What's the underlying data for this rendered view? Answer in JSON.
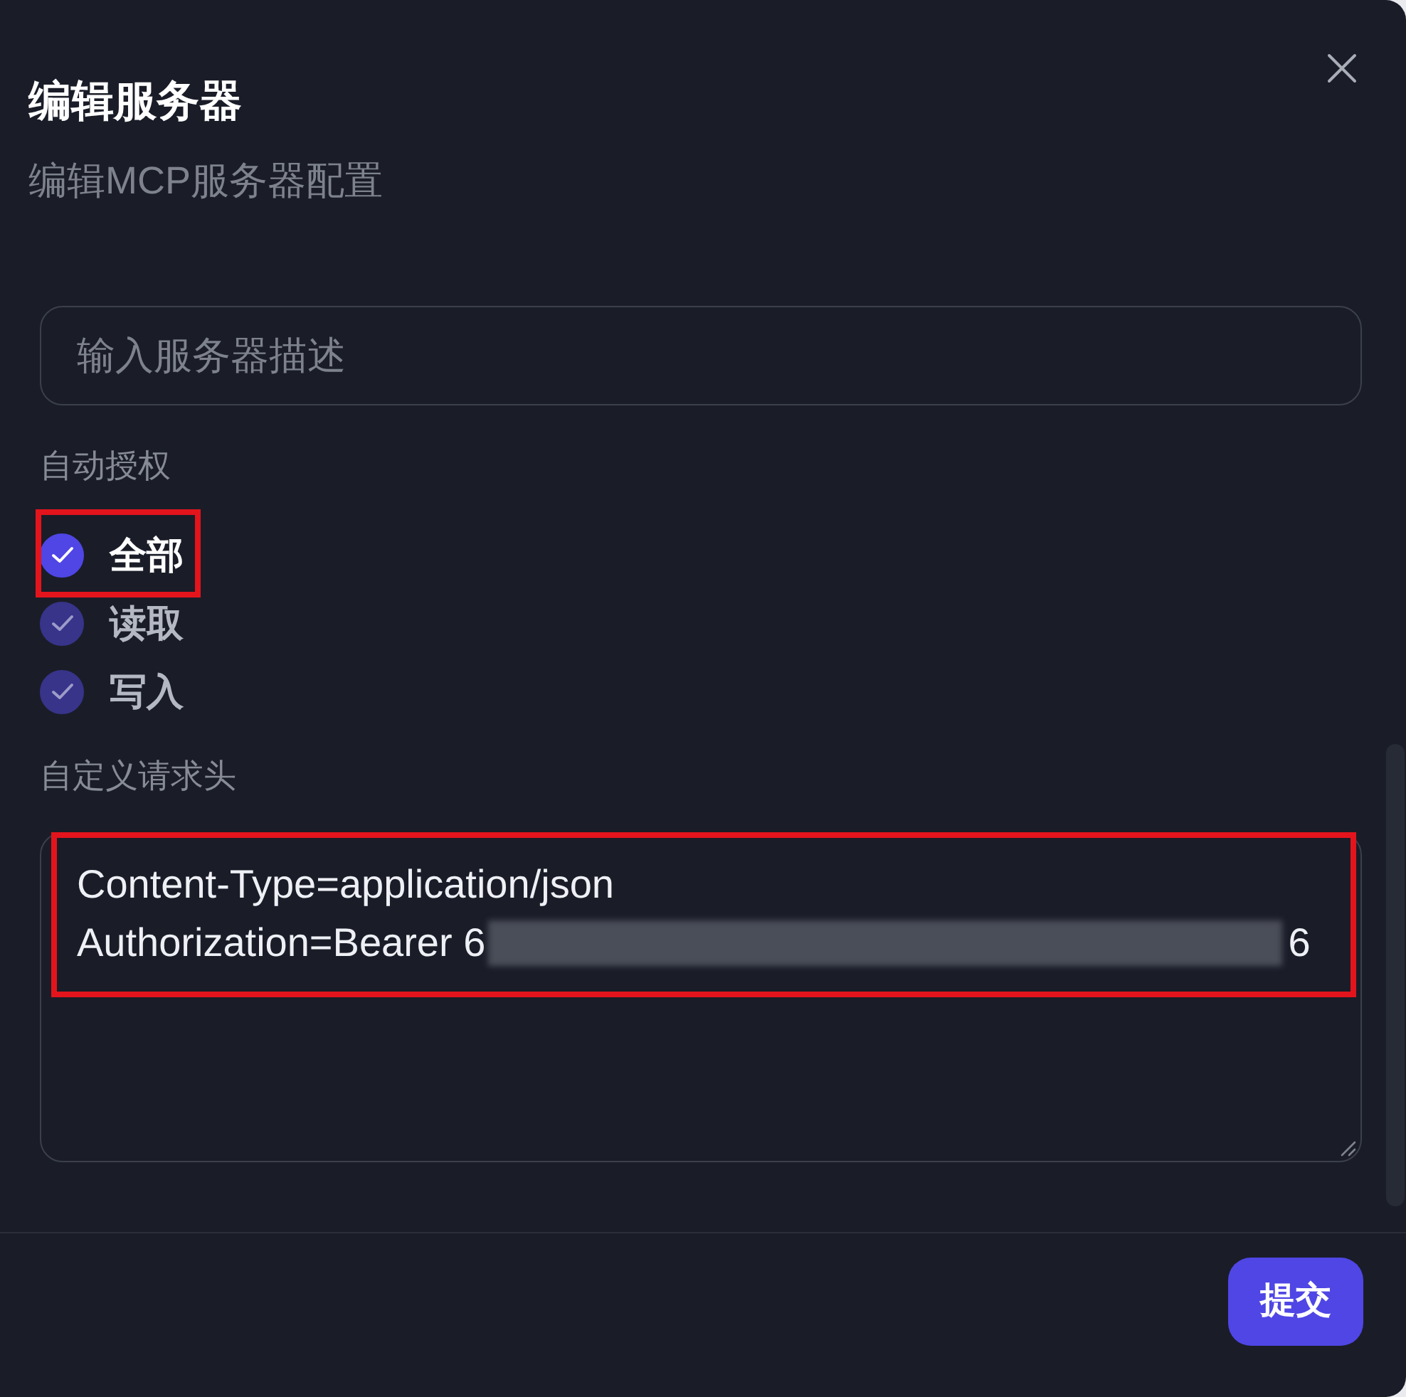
{
  "dialog": {
    "title": "编辑服务器",
    "subtitle": "编辑MCP服务器配置"
  },
  "description_field": {
    "placeholder": "输入服务器描述"
  },
  "auto_auth": {
    "label": "自动授权",
    "options": [
      {
        "label": "全部",
        "checked": true,
        "disabled": false,
        "highlighted": true
      },
      {
        "label": "读取",
        "checked": true,
        "disabled": true,
        "highlighted": false
      },
      {
        "label": "写入",
        "checked": true,
        "disabled": true,
        "highlighted": false
      }
    ]
  },
  "headers": {
    "label": "自定义请求头",
    "highlighted": true,
    "lines": [
      {
        "kind": "plain",
        "text": "Content-Type=application/json"
      },
      {
        "kind": "redacted",
        "text": "Authorization=Bearer 6",
        "tail": "6"
      }
    ]
  },
  "submit_button": {
    "label": "提交"
  }
}
